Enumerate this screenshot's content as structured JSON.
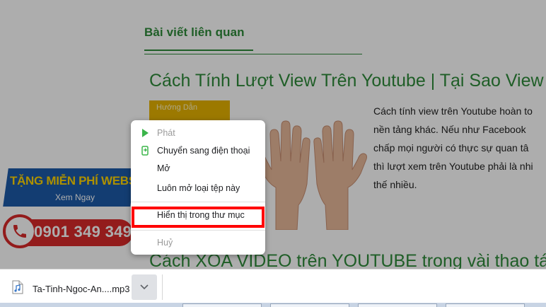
{
  "article": {
    "section_title": "Bài viết liên quan",
    "post_title": "Cách Tính Lượt View Trên Youtube | Tại Sao View Youtu",
    "thumb_badge": "Hướng Dẫn",
    "excerpt_lines": [
      "Cách tính view trên Youtube hoàn to",
      "nền tảng khác. Nếu như Facebook",
      "chấp mọi người có thực sự quan tâ",
      "thì lượt xem trên Youtube phải là nhi",
      "thế nhiều."
    ],
    "second_title": "Cách XÓA VIDEO trên YOUTUBE trong vài thao tác"
  },
  "promo": {
    "banner_text": "TẶNG MIỄN PHÍ WEBSITE",
    "banner_sub": "Xem Ngay",
    "phone": "0901 349 349"
  },
  "context_menu": {
    "items": [
      {
        "label": "Phát",
        "icon": "play-icon",
        "disabled": true
      },
      {
        "label": "Chuyển sang điện thoại",
        "icon": "send-to-phone-icon",
        "disabled": false
      },
      {
        "label": "Mở",
        "icon": "",
        "disabled": false
      },
      {
        "label": "Luôn mở loại tệp này",
        "icon": "",
        "disabled": false
      },
      {
        "label": "Hiển thị trong thư mục",
        "icon": "",
        "disabled": false
      },
      {
        "label": "Huỷ",
        "icon": "",
        "disabled": true
      }
    ]
  },
  "download_bar": {
    "filename": "Ta-Tinh-Ngoc-An....mp3",
    "file_icon": "audio-file-icon",
    "menu_icon": "chevron-down-icon"
  },
  "colors": {
    "accent_green": "#2e8b3a",
    "highlight_red": "#ff0000",
    "promo_blue": "#1c5aa8",
    "promo_yellow": "#ffd400",
    "phone_red": "#d92a2a"
  }
}
